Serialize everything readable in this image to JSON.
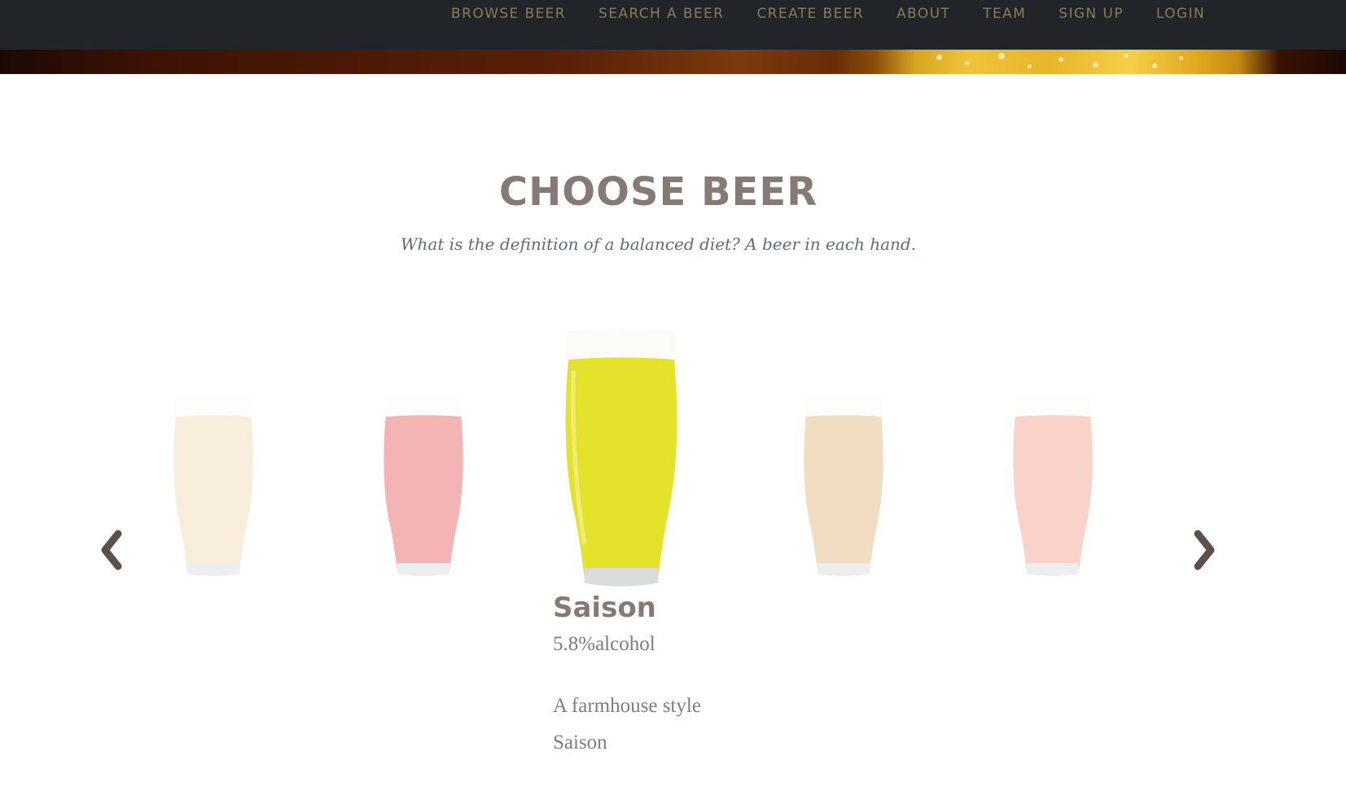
{
  "nav": {
    "items": [
      {
        "label": "BROWSE BEER"
      },
      {
        "label": "SEARCH A BEER"
      },
      {
        "label": "CREATE BEER"
      },
      {
        "label": "ABOUT"
      },
      {
        "label": "TEAM"
      },
      {
        "label": "SIGN UP"
      },
      {
        "label": "LOGIN"
      }
    ]
  },
  "section": {
    "heading": "CHOOSE BEER",
    "subheading": "What is the definition of a balanced diet? A beer in each hand."
  },
  "carousel": {
    "prev_icon": "chevron-left-icon",
    "next_icon": "chevron-right-icon",
    "glasses": [
      {
        "color": "#f3d8b0",
        "selected": false
      },
      {
        "color": "#e85a5f",
        "selected": false
      },
      {
        "color": "#e4e22b",
        "selected": true
      },
      {
        "color": "#e2b579",
        "selected": false
      },
      {
        "color": "#f49d8c",
        "selected": false
      }
    ]
  },
  "selected_beer": {
    "name": "Saison",
    "alcohol": "5.8%alcohol",
    "description": "A farmhouse style Saison"
  },
  "colors": {
    "navbar_bg": "#212529",
    "nav_text": "#8a7a56",
    "heading": "#857a74",
    "subheading": "#5f6b78"
  }
}
